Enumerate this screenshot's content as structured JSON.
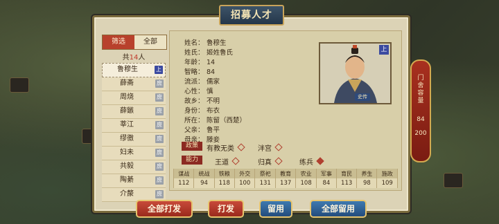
{
  "title": "招募人才",
  "filter": {
    "active_label": "筛选",
    "inactive_label": "全部"
  },
  "count": {
    "prefix": "共",
    "number": "14",
    "suffix": "人"
  },
  "list": [
    {
      "name": "鲁穆生",
      "tag": "上",
      "selected": true
    },
    {
      "name": "薛斋",
      "tag": "庶"
    },
    {
      "name": "周烧",
      "tag": "庶"
    },
    {
      "name": "薛鏃",
      "tag": "庶"
    },
    {
      "name": "莘江",
      "tag": "庶"
    },
    {
      "name": "缪徼",
      "tag": "庶"
    },
    {
      "name": "妇未",
      "tag": "庶"
    },
    {
      "name": "共毅",
      "tag": "庶"
    },
    {
      "name": "陶綦",
      "tag": "庶"
    },
    {
      "name": "介漦",
      "tag": "庶"
    }
  ],
  "details": [
    {
      "label": "姓名：",
      "value": "鲁穆生"
    },
    {
      "label": "姓氏：",
      "value": "姬姓鲁氏"
    },
    {
      "label": "年龄：",
      "value": "14"
    },
    {
      "label": "智略：",
      "value": "84"
    },
    {
      "label": "流派：",
      "value": "儒家"
    },
    {
      "label": "心性：",
      "value": "慎"
    },
    {
      "label": "故乡：",
      "value": "不明"
    },
    {
      "label": "身份：",
      "value": "布衣"
    },
    {
      "label": "所在：",
      "value": "陈留（西楚）"
    },
    {
      "label": "父亲：",
      "value": "鲁平"
    },
    {
      "label": "母亲：",
      "value": "滕妾"
    }
  ],
  "portrait": {
    "badge": "上",
    "tag": "史传"
  },
  "policy": {
    "label": "政策",
    "items": [
      "有教无类",
      "泮宫"
    ]
  },
  "ability": {
    "label": "能力",
    "items": [
      "王道",
      "归真",
      "练兵"
    ]
  },
  "stats": {
    "headers": [
      "谋战",
      "统战",
      "铁粮",
      "外交",
      "祭祀",
      "教育",
      "农业",
      "军事",
      "育民",
      "养生",
      "施政"
    ],
    "values": [
      "112",
      "94",
      "118",
      "100",
      "131",
      "137",
      "108",
      "84",
      "113",
      "98",
      "109"
    ]
  },
  "capacity": {
    "label": "门舍容量",
    "current": "84",
    "max": "200"
  },
  "buttons": {
    "dismiss_all": "全部打发",
    "dismiss": "打发",
    "keep": "留用",
    "keep_all": "全部留用"
  }
}
